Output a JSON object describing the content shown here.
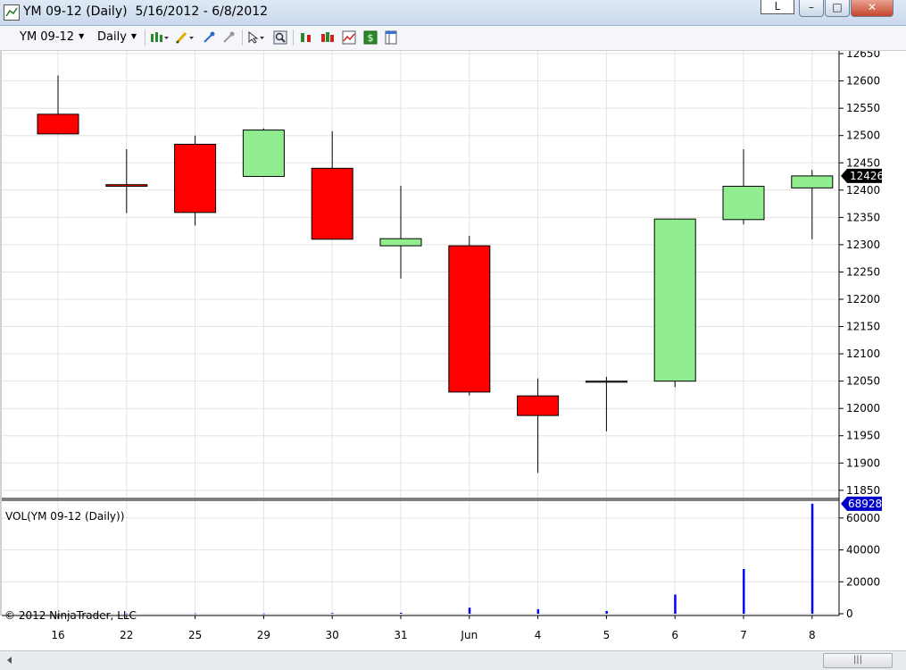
{
  "window": {
    "title": "YM 09-12 (Daily)  5/16/2012 - 6/8/2012",
    "link_button_label": "L",
    "minimize_glyph": "–",
    "maximize_glyph": "□",
    "close_glyph": "✕"
  },
  "toolbar": {
    "instrument": "YM 09-12",
    "interval": "Daily",
    "icons": [
      "chart-style-icon",
      "draw-pencil-icon",
      "crosshair-icon",
      "global-crosshair-icon",
      "select-pointer-icon",
      "zoom-icon",
      "bars-icon",
      "data-series-icon",
      "indicators-icon",
      "strategies-icon",
      "properties-icon"
    ]
  },
  "colors": {
    "up_candle": "#90ee90",
    "down_candle": "#ff0000",
    "volume_bar": "#0000ff",
    "price_marker": "#000000",
    "volume_marker": "#0000cc",
    "grid": "#e3e3e3"
  },
  "chart_data": {
    "type": "candlestick",
    "instrument": "YM 09-12",
    "interval": "Daily",
    "date_range": "5/16/2012 - 6/8/2012",
    "x_tick_labels": [
      "16",
      "22",
      "25",
      "29",
      "30",
      "31",
      "Jun",
      "4",
      "5",
      "6",
      "7",
      "8"
    ],
    "candles": [
      {
        "label": "16",
        "open": 12539,
        "high": 12610,
        "low": 12502,
        "close": 12503
      },
      {
        "label": "22",
        "open": 12410,
        "high": 12475,
        "low": 12358,
        "close": 12407
      },
      {
        "label": "25",
        "open": 12484,
        "high": 12500,
        "low": 12335,
        "close": 12359
      },
      {
        "label": "29",
        "open": 12425,
        "high": 12513,
        "low": 12425,
        "close": 12510
      },
      {
        "label": "30",
        "open": 12440,
        "high": 12508,
        "low": 12310,
        "close": 12310
      },
      {
        "label": "31",
        "open": 12298,
        "high": 12408,
        "low": 12238,
        "close": 12311
      },
      {
        "label": "Jun",
        "open": 12298,
        "high": 12316,
        "low": 12024,
        "close": 12030
      },
      {
        "label": "4",
        "open": 12023,
        "high": 12055,
        "low": 11882,
        "close": 11987
      },
      {
        "label": "5",
        "open": 12048,
        "high": 12058,
        "low": 11958,
        "close": 12050
      },
      {
        "label": "6",
        "open": 12050,
        "high": 12347,
        "low": 12039,
        "close": 12347
      },
      {
        "label": "7",
        "open": 12346,
        "high": 12475,
        "low": 12337,
        "close": 12407
      },
      {
        "label": "8",
        "open": 12404,
        "high": 12437,
        "low": 12310,
        "close": 12426
      }
    ],
    "price_axis": {
      "ticks": [
        11850,
        11900,
        11950,
        12000,
        12050,
        12100,
        12150,
        12200,
        12250,
        12300,
        12350,
        12400,
        12450,
        12500,
        12550,
        12600,
        12650
      ],
      "range": [
        11835,
        12655
      ],
      "last_price_marker": "12426"
    },
    "volume_panel": {
      "label": "VOL(YM 09-12 (Daily))",
      "values": [
        20,
        40,
        150,
        80,
        450,
        600,
        3800,
        2800,
        1700,
        12000,
        28000,
        68928
      ],
      "ticks": [
        "0",
        "20000",
        "40000",
        "60000"
      ],
      "tick_values": [
        0,
        20000,
        40000,
        60000
      ],
      "range": [
        0,
        70000
      ],
      "last_volume_marker": "68928"
    },
    "grid": true,
    "copyright": "© 2012 NinjaTrader, LLC"
  }
}
